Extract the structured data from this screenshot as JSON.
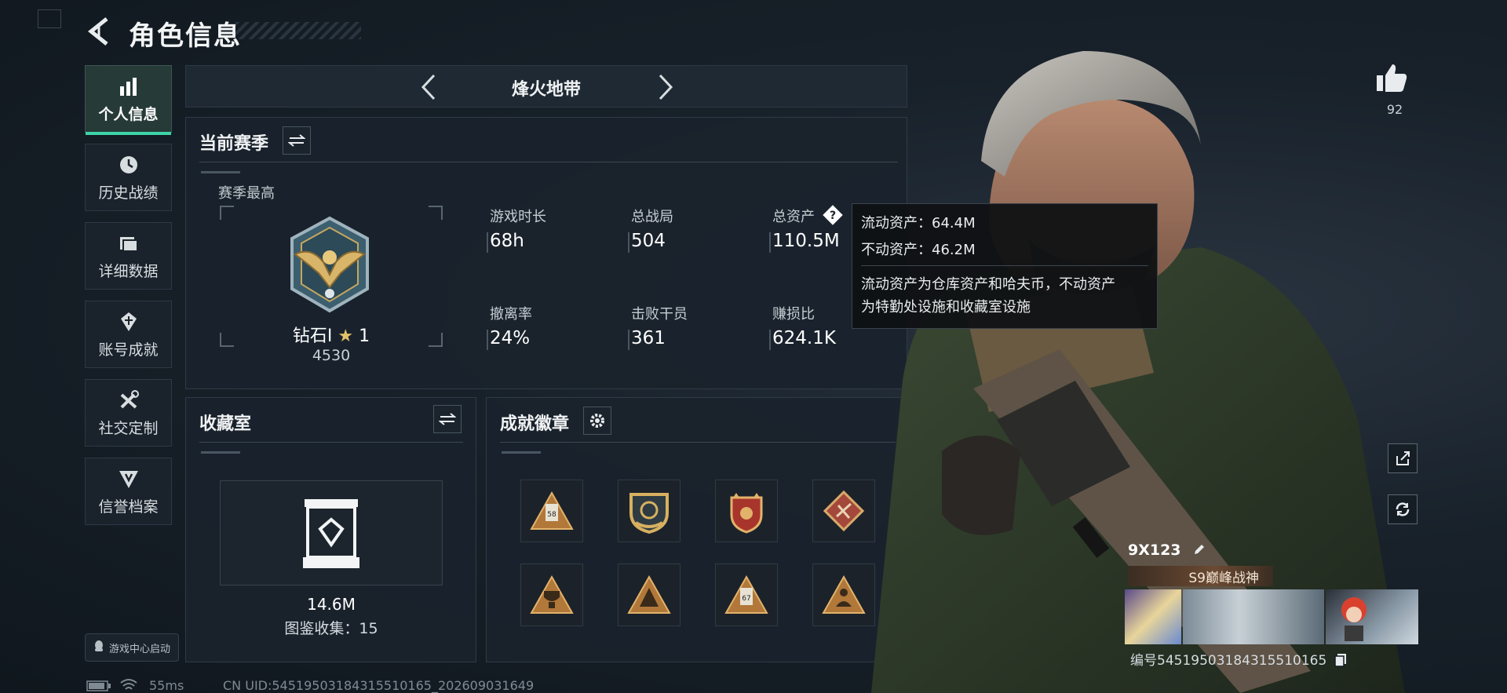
{
  "header": {
    "title": "角色信息"
  },
  "nav": {
    "items": [
      {
        "label": "个人信息",
        "icon": "bar-chart-icon",
        "active": true
      },
      {
        "label": "历史战绩",
        "icon": "clock-icon",
        "active": false
      },
      {
        "label": "详细数据",
        "icon": "folder-icon",
        "active": false
      },
      {
        "label": "账号成就",
        "icon": "medal-icon",
        "active": false
      },
      {
        "label": "社交定制",
        "icon": "tools-icon",
        "active": false
      },
      {
        "label": "信誉档案",
        "icon": "shield-icon",
        "active": false
      }
    ],
    "game_center": "游戏中心启动"
  },
  "mode": {
    "title": "烽火地带"
  },
  "season": {
    "title": "当前赛季",
    "peak_label": "赛季最高",
    "rank_name": "钻石I",
    "rank_stars": "1",
    "rank_points": "4530",
    "stats": [
      {
        "label": "游戏时长",
        "value": "68h"
      },
      {
        "label": "总战局",
        "value": "504"
      },
      {
        "label": "总资产",
        "value": "110.5M"
      },
      {
        "label": "撤离率",
        "value": "24%"
      },
      {
        "label": "击败干员",
        "value": "361"
      },
      {
        "label": "赚损比",
        "value": "624.1K"
      }
    ]
  },
  "tooltip": {
    "liquid": "流动资产：64.4M",
    "fixed": "不动资产：46.2M",
    "desc_line1": "流动资产为仓库资产和哈夫币，不动资产",
    "desc_line2": "为特勤处设施和收藏室设施"
  },
  "collection": {
    "title": "收藏室",
    "value": "14.6M",
    "catalog": "图鉴收集：15"
  },
  "badges": {
    "title": "成就徽章",
    "items": [
      "badge-triangle-58",
      "badge-shield-gold",
      "badge-red-crest",
      "badge-red-diamond",
      "badge-triangle-trophy",
      "badge-triangle-mountain",
      "badge-triangle-67",
      "badge-triangle-rider"
    ]
  },
  "character": {
    "likes": "92",
    "player_name": "9X123",
    "title": "S9巅峰战神",
    "id_text": "编号545195031843155101​65"
  },
  "status_bar": {
    "ping": "55ms",
    "uid": "CN UID:5451950318431551016​5_202609031649"
  },
  "colors": {
    "accent": "#3ed3a8",
    "panel": "#1a232c",
    "gold": "#c9974a"
  }
}
